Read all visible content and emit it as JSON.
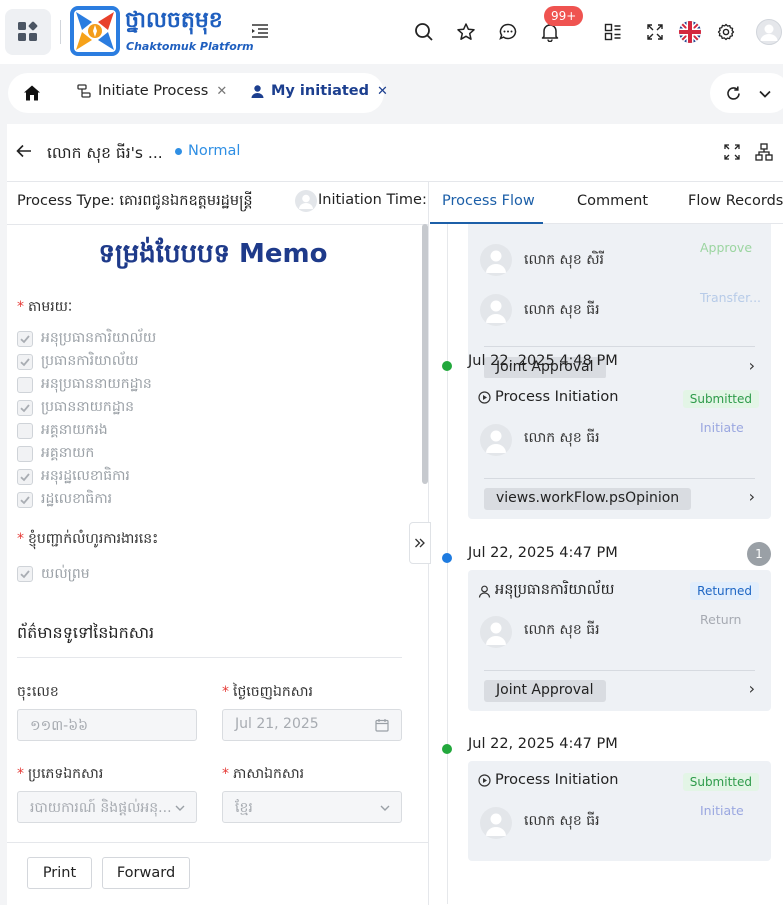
{
  "app": {
    "logo_text_khmer": "ថ្នាលចតុមុខ",
    "logo_text_latin": "Chaktomuk Platform",
    "notification_count": "99+"
  },
  "tabs": [
    {
      "label": "Initiate Process",
      "active": false
    },
    {
      "label": "My initiated",
      "active": true
    }
  ],
  "document": {
    "title": "លោក សុខ ធីរ's ...",
    "status": "Normal"
  },
  "left": {
    "process_type_label": "Process Type:",
    "process_type_value": "គោរពជូនឯកឧត្តមរដ្ឋមន្ត្រី",
    "initiation_time_label": "Initiation Time:",
    "form_title": "ទម្រង់បែបបទ Memo",
    "via_label": "តាមរយៈ",
    "via_options": [
      {
        "label": "អនុប្រធានការិយាល័យ",
        "checked": true
      },
      {
        "label": "ប្រធានការិយាល័យ",
        "checked": true
      },
      {
        "label": "អនុប្រធាននាយកដ្ឋាន",
        "checked": false
      },
      {
        "label": "ប្រធាននាយកដ្ឋាន",
        "checked": true
      },
      {
        "label": "អគ្គនាយករង",
        "checked": false
      },
      {
        "label": "អគ្គនាយក",
        "checked": false
      },
      {
        "label": "អនុរដ្ឋលេខាធិការ",
        "checked": true
      },
      {
        "label": "រដ្ឋលេខាធិការ",
        "checked": true
      }
    ],
    "confirm_label": "ខ្ញុំបញ្ជាក់លំហូរការងារនេះ",
    "confirm_option": {
      "label": "យល់ព្រម",
      "checked": true
    },
    "section_title": "ព័ត៌មានទូទៅនៃឯកសារ",
    "fields": {
      "number_label": "ចុះលេខ",
      "number_value": "១១៣-៦៦",
      "issue_date_label": "ថ្ងៃចេញឯកសារ",
      "issue_date_value": "Jul 21, 2025",
      "doc_type_label": "ប្រភេទឯកសារ",
      "doc_type_value": "របាយការណ៍ និងផ្តល់អនុ...",
      "language_label": "ភាសាឯកសារ",
      "language_value": "ខ្មែរ"
    },
    "buttons": {
      "print": "Print",
      "forward": "Forward"
    }
  },
  "right": {
    "tabs": [
      "Process Flow",
      "Comment",
      "Flow Records"
    ],
    "active_tab": "Process Flow",
    "top_card": {
      "people": [
        {
          "name": "លោក សុខ សិរី",
          "action": "Approve"
        },
        {
          "name": "លោក សុខ ធីរ",
          "action": "Transfer..."
        }
      ],
      "opinion": "Joint Approval"
    },
    "steps": [
      {
        "date": "Jul 22, 2025 4:48 PM",
        "title": "Process Initiation",
        "tag": "Submitted",
        "person": "លោក សុខ ធីរ",
        "action": "Initiate",
        "opinion": "views.workFlow.psOpinion",
        "dot": "#22a83c"
      },
      {
        "date": "Jul 22, 2025 4:47 PM",
        "title": "អនុប្រធានការិយាល័យ",
        "tag": "Returned",
        "person": "លោក សុខ ធីរ",
        "action": "Return",
        "opinion": "Joint Approval",
        "dot": "#1e7be0",
        "count": "1"
      },
      {
        "date": "Jul 22, 2025 4:47 PM",
        "title": "Process Initiation",
        "tag": "Submitted",
        "person": "លោក សុខ ធីរ",
        "action": "Initiate",
        "dot": "#22a83c"
      }
    ]
  }
}
